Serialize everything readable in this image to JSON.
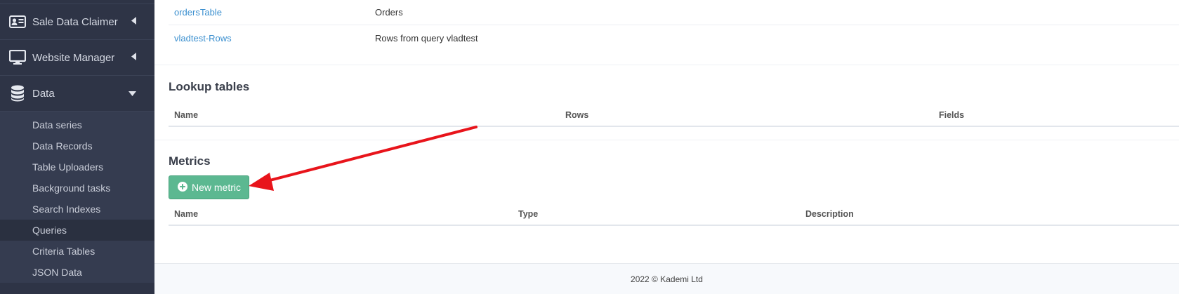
{
  "sidebar": {
    "items": [
      {
        "label": "Sale Data Claimer",
        "icon": "id-card-icon"
      },
      {
        "label": "Website Manager",
        "icon": "monitor-icon"
      },
      {
        "label": "Data",
        "icon": "database-icon"
      }
    ],
    "sub_items": [
      {
        "label": "Data series"
      },
      {
        "label": "Data Records"
      },
      {
        "label": "Table Uploaders"
      },
      {
        "label": "Background tasks"
      },
      {
        "label": "Search Indexes"
      },
      {
        "label": "Queries"
      },
      {
        "label": "Criteria Tables"
      },
      {
        "label": "JSON Data"
      }
    ]
  },
  "tables_list": {
    "rows": [
      {
        "name": "ordersTable",
        "description": "Orders"
      },
      {
        "name": "vladtest-Rows",
        "description": "Rows from query vladtest"
      }
    ]
  },
  "lookup": {
    "title": "Lookup tables",
    "col_name": "Name",
    "col_rows": "Rows",
    "col_fields": "Fields"
  },
  "metrics": {
    "title": "Metrics",
    "new_button": "New metric",
    "col_name": "Name",
    "col_type": "Type",
    "col_description": "Description"
  },
  "footer": {
    "text": "2022 © Kademi Ltd"
  },
  "colors": {
    "sidebar_bg": "#2e3446",
    "link": "#3a8fcf",
    "button": "#5cb891",
    "arrow": "#e8141b"
  }
}
